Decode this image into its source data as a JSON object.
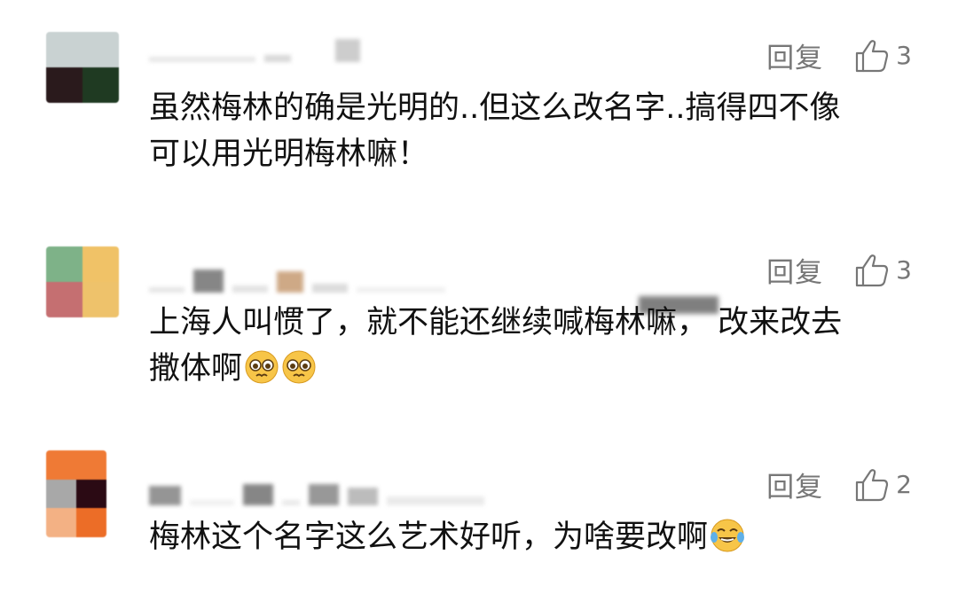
{
  "comments": [
    {
      "reply_label": "回复",
      "like_count": "3",
      "text_lines": [
        "虽然梅林的确是光明的..但这么改名字..搞得四不像",
        "可以用光明梅林嘛！"
      ],
      "emojis": [],
      "avatar_colors": [
        "#c9d2d2",
        "#c9d2d2",
        "#2a1a1c",
        "#1f3a22"
      ]
    },
    {
      "reply_label": "回复",
      "like_count": "3",
      "text_lines": [
        "上海人叫惯了，就不能还继续喊梅林嘛，  改来改去",
        "撒体啊"
      ],
      "emojis": [
        "pleading-face-icon",
        "pleading-face-icon"
      ],
      "avatar_colors": [
        "#7eb288",
        "#f0c267",
        "#c56f71",
        "#eec26b"
      ]
    },
    {
      "reply_label": "回复",
      "like_count": "2",
      "text_lines": [
        "梅林这个名字这么艺术好听，为啥要改啊"
      ],
      "emojis": [
        "tears-of-joy-icon"
      ],
      "avatar_colors": [
        "#a8a8a8",
        "#2b0a14",
        "#f3b184",
        "#ec6d27"
      ]
    }
  ],
  "colors": {
    "text": "#111111",
    "muted": "#777777",
    "background": "#ffffff",
    "emoji_yellow": "#f7c548"
  }
}
